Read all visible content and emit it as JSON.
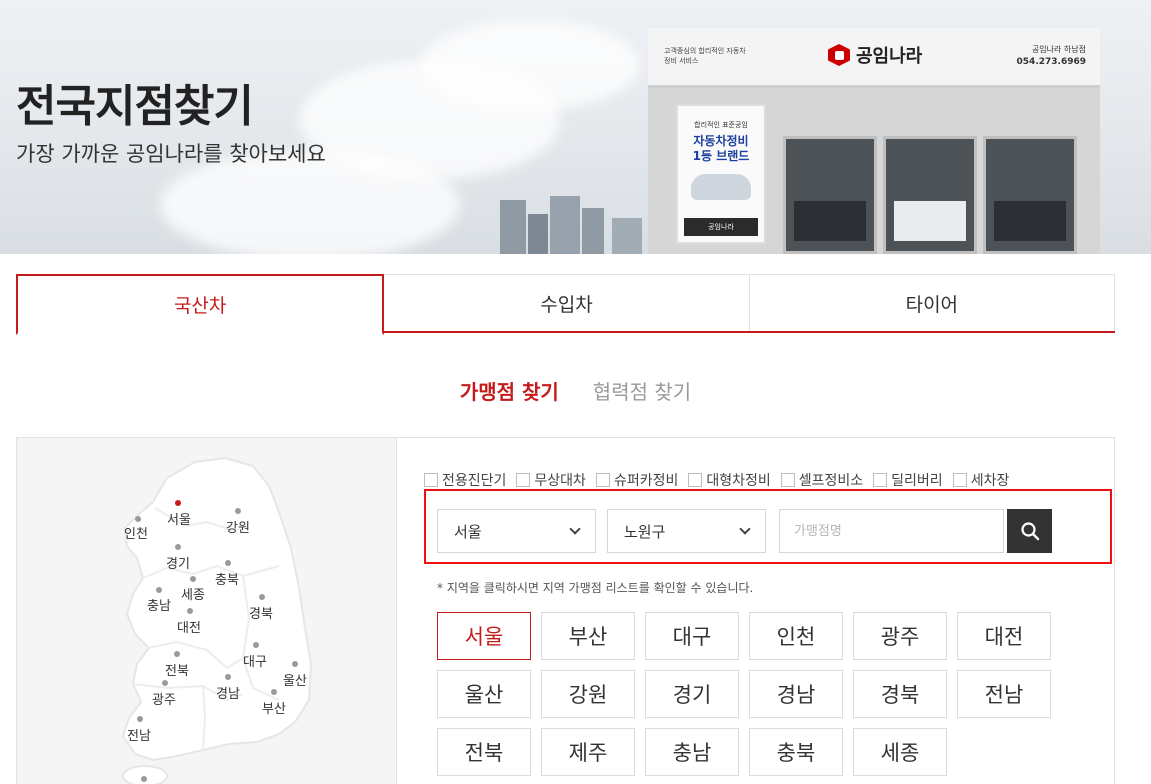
{
  "hero": {
    "title": "전국지점찾기",
    "subtitle": "가장 가까운 공임나라를 찾아보세요",
    "sign_left": "고객중심의 합리적인 자동차 정비 서비스",
    "brand": "공임나라",
    "sign_right_name": "공임나라 하남점",
    "sign_right_phone": "054.273.6969",
    "poster_top": "합리적인 표준공임",
    "poster_main_1": "자동차정비",
    "poster_main_2": "1등 브랜드",
    "poster_foot": "공임나라"
  },
  "main_tabs": [
    {
      "label": "국산차",
      "active": true
    },
    {
      "label": "수입차",
      "active": false
    },
    {
      "label": "타이어",
      "active": false
    }
  ],
  "sub_tabs": [
    {
      "label": "가맹점 찾기",
      "active": true
    },
    {
      "label": "협력점 찾기",
      "active": false
    }
  ],
  "map_regions": [
    {
      "label": "서울",
      "active": true
    },
    {
      "label": "인천",
      "active": false
    },
    {
      "label": "강원",
      "active": false
    },
    {
      "label": "경기",
      "active": false
    },
    {
      "label": "충북",
      "active": false
    },
    {
      "label": "세종",
      "active": false
    },
    {
      "label": "충남",
      "active": false
    },
    {
      "label": "대전",
      "active": false
    },
    {
      "label": "경북",
      "active": false
    },
    {
      "label": "대구",
      "active": false
    },
    {
      "label": "전북",
      "active": false
    },
    {
      "label": "울산",
      "active": false
    },
    {
      "label": "경남",
      "active": false
    },
    {
      "label": "광주",
      "active": false
    },
    {
      "label": "부산",
      "active": false
    },
    {
      "label": "전남",
      "active": false
    }
  ],
  "filters": [
    {
      "label": "전용진단기",
      "checked": false
    },
    {
      "label": "무상대차",
      "checked": false
    },
    {
      "label": "슈퍼카정비",
      "checked": false
    },
    {
      "label": "대형차정비",
      "checked": false
    },
    {
      "label": "셀프정비소",
      "checked": false
    },
    {
      "label": "딜리버리",
      "checked": false
    },
    {
      "label": "세차장",
      "checked": false
    }
  ],
  "search": {
    "region_select": "서울",
    "district_select": "노원구",
    "placeholder": "가맹점명"
  },
  "note": "* 지역을 클릭하시면 지역 가맹점 리스트를 확인할 수 있습니다.",
  "region_buttons": [
    {
      "label": "서울",
      "active": true
    },
    {
      "label": "부산",
      "active": false
    },
    {
      "label": "대구",
      "active": false
    },
    {
      "label": "인천",
      "active": false
    },
    {
      "label": "광주",
      "active": false
    },
    {
      "label": "대전",
      "active": false
    },
    {
      "label": "울산",
      "active": false
    },
    {
      "label": "강원",
      "active": false
    },
    {
      "label": "경기",
      "active": false
    },
    {
      "label": "경남",
      "active": false
    },
    {
      "label": "경북",
      "active": false
    },
    {
      "label": "전남",
      "active": false
    },
    {
      "label": "전북",
      "active": false
    },
    {
      "label": "제주",
      "active": false
    },
    {
      "label": "충남",
      "active": false
    },
    {
      "label": "충북",
      "active": false
    },
    {
      "label": "세종",
      "active": false
    }
  ],
  "colors": {
    "accent": "#c51b1b",
    "highlight_border": "#ee1111",
    "search_button": "#333333"
  }
}
